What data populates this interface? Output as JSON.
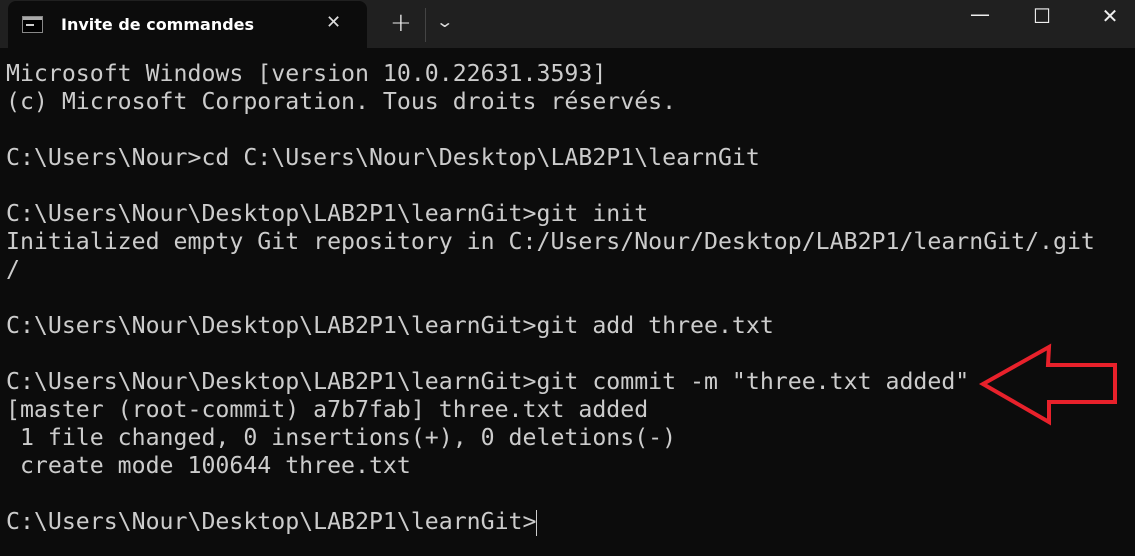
{
  "window": {
    "tab_title": "Invite de commandes",
    "tab_icon": "cmd-icon",
    "controls": [
      "minimize-icon",
      "maximize-icon",
      "close-icon"
    ]
  },
  "terminal": {
    "lines": [
      "Microsoft Windows [version 10.0.22631.3593]",
      "(c) Microsoft Corporation. Tous droits réservés.",
      "",
      "C:\\Users\\Nour>cd C:\\Users\\Nour\\Desktop\\LAB2P1\\learnGit",
      "",
      "C:\\Users\\Nour\\Desktop\\LAB2P1\\learnGit>git init",
      "Initialized empty Git repository in C:/Users/Nour/Desktop/LAB2P1/learnGit/.git",
      "/",
      "",
      "C:\\Users\\Nour\\Desktop\\LAB2P1\\learnGit>git add three.txt",
      "",
      "C:\\Users\\Nour\\Desktop\\LAB2P1\\learnGit>git commit -m \"three.txt added\"",
      "[master (root-commit) a7b7fab] three.txt added",
      " 1 file changed, 0 insertions(+), 0 deletions(-)",
      " create mode 100644 three.txt",
      "",
      "C:\\Users\\Nour\\Desktop\\LAB2P1\\learnGit>"
    ]
  },
  "annotation": {
    "shape": "arrow-left",
    "color": "#e8212b"
  }
}
